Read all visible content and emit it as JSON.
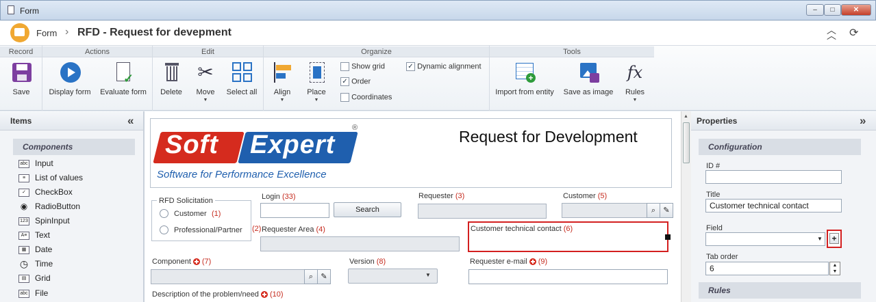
{
  "window": {
    "title": "Form",
    "minimize": "‒",
    "maximize": "□",
    "close": "✕"
  },
  "header": {
    "breadcrumb_root": "Form",
    "separator": "›",
    "title": "RFD - Request for devepment"
  },
  "ribbon": {
    "groups": {
      "record": "Record",
      "actions": "Actions",
      "edit": "Edit",
      "organize": "Organize",
      "tools": "Tools"
    },
    "save": "Save",
    "display_form": "Display form",
    "evaluate_form": "Evaluate form",
    "delete": "Delete",
    "move": "Move",
    "select_all": "Select all",
    "align": "Align",
    "place": "Place",
    "show_grid": {
      "label": "Show grid",
      "checked": false
    },
    "order": {
      "label": "Order",
      "checked": true
    },
    "coordinates": {
      "label": "Coordinates",
      "checked": false
    },
    "dynamic_alignment": {
      "label": "Dynamic alignment",
      "checked": true
    },
    "import_from_entity": "Import from entity",
    "save_as_image": "Save as image",
    "rules": "Rules",
    "rules_glyph": "fx"
  },
  "items_panel": {
    "title": "Items",
    "collapse": "«",
    "section": "Components",
    "components": [
      {
        "label": "Input",
        "icon": "abc"
      },
      {
        "label": "List of values",
        "icon": "≡"
      },
      {
        "label": "CheckBox",
        "icon": "✓"
      },
      {
        "label": "RadioButton",
        "icon": "◉"
      },
      {
        "label": "SpinInput",
        "icon": "123"
      },
      {
        "label": "Text",
        "icon": "A≡"
      },
      {
        "label": "Date",
        "icon": "▦"
      },
      {
        "label": "Time",
        "icon": "◷"
      },
      {
        "label": "Grid",
        "icon": "▤"
      },
      {
        "label": "File",
        "icon": "abc"
      }
    ]
  },
  "form": {
    "logo_soft": "Soft",
    "logo_expert": "Expert",
    "logo_registered": "®",
    "logo_tagline": "Software for Performance Excellence",
    "heading": "Request for Development",
    "rfd_group": "RFD Solicitation",
    "radio_customer": "Customer",
    "radio_customer_num": "(1)",
    "radio_partner": "Professional/Partner",
    "radio_partner_num": "(2)",
    "login": "Login",
    "login_num": "(33)",
    "search_button": "Search",
    "requester": "Requester",
    "requester_num": "(3)",
    "customer": "Customer",
    "customer_num": "(5)",
    "requester_area": "Requester Area",
    "requester_area_num": "(4)",
    "customer_technical_contact": "Customer technical contact",
    "customer_technical_contact_num": "(6)",
    "component": "Component",
    "component_num": "(7)",
    "version": "Version",
    "version_num": "(8)",
    "requester_email": "Requester e-mail",
    "requester_email_num": "(9)",
    "description": "Description of the problem/need",
    "description_num": "(10)"
  },
  "properties_panel": {
    "title": "Properties",
    "expand": "»",
    "section": "Configuration",
    "id_label": "ID #",
    "id_value": "",
    "title_label": "Title",
    "title_value": "Customer technical contact",
    "field_label": "Field",
    "field_value": "",
    "add_field": "+",
    "tab_order_label": "Tab order",
    "tab_order_value": "6",
    "rules_section": "Rules"
  },
  "colors": {
    "logo_red": "#d52b1e",
    "logo_blue": "#1f5fae",
    "required": "#c52a1d",
    "highlight_border": "#d31f1f"
  }
}
